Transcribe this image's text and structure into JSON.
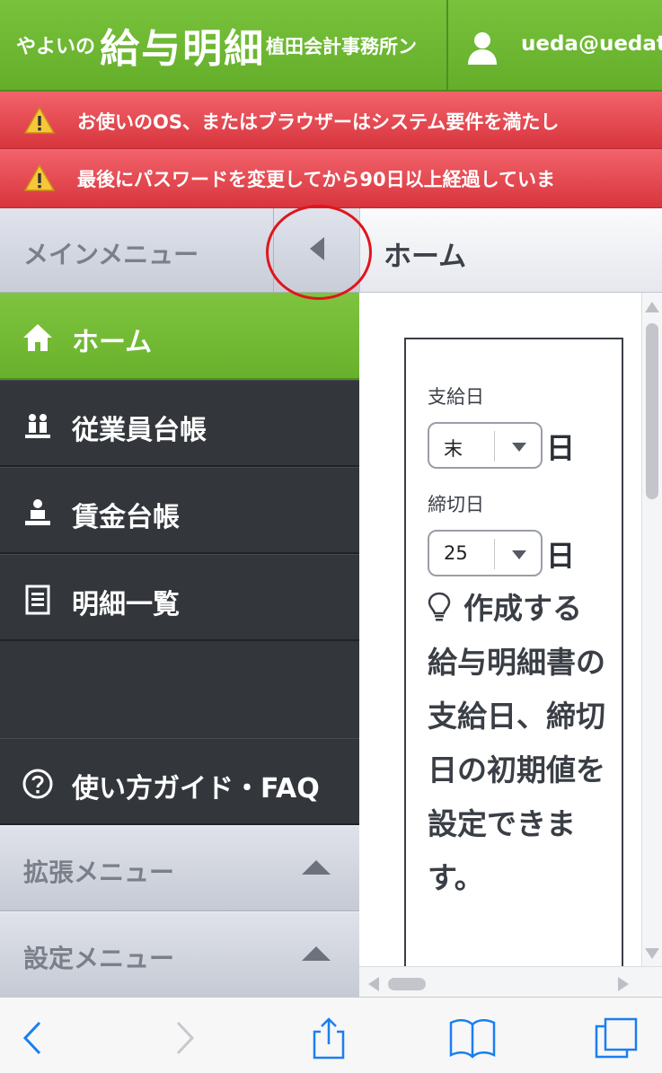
{
  "header": {
    "logo_small": "やよいの",
    "logo_big": "給与明細",
    "company": "植田会計事務所ン",
    "user_email": "ueda@uedat"
  },
  "alerts": [
    {
      "text": "お使いのOS、またはブラウザーはシステム要件を満たし"
    },
    {
      "text": "最後にパスワードを変更してから90日以上経過していま"
    }
  ],
  "sidebar": {
    "title": "メインメニュー",
    "items": [
      {
        "label": "ホーム",
        "icon": "home-icon",
        "active": true
      },
      {
        "label": "従業員台帳",
        "icon": "employees-icon"
      },
      {
        "label": "賃金台帳",
        "icon": "wage-ledger-icon"
      },
      {
        "label": "明細一覧",
        "icon": "list-icon"
      },
      {
        "label": "使い方ガイド・FAQ",
        "icon": "help-icon"
      }
    ],
    "extended_menu": "拡張メニュー",
    "settings_menu": "設定メニュー"
  },
  "main": {
    "title": "ホーム",
    "pay_day_label": "支給日",
    "pay_day_value": "末",
    "pay_day_unit": "日",
    "cutoff_label": "締切日",
    "cutoff_value": "25",
    "cutoff_unit": "日",
    "hint": "作成する給与明細書の支給日、締切日の初期値を設定できます。"
  },
  "colors": {
    "brand_green": "#6fb733",
    "alert_red": "#e0444b",
    "sidebar_dark": "#33373c",
    "annotation_red": "#e0161c"
  }
}
